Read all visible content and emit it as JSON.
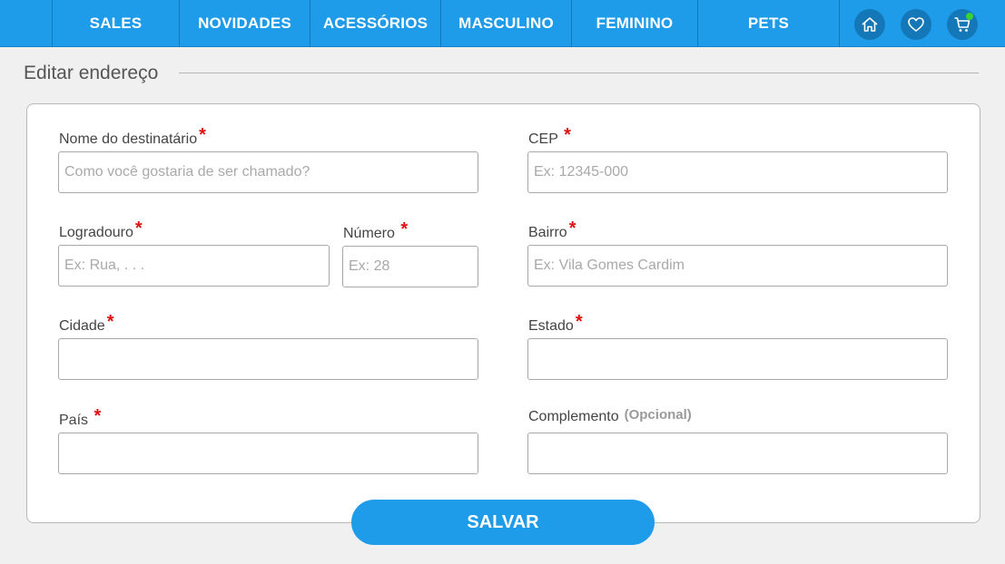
{
  "nav": {
    "items": [
      {
        "label": "SALES"
      },
      {
        "label": "NOVIDADES"
      },
      {
        "label": "ACESSÓRIOS"
      },
      {
        "label": "MASCULINO"
      },
      {
        "label": "FEMININO"
      },
      {
        "label": "PETS"
      }
    ],
    "icons": [
      "home-icon",
      "heart-icon",
      "cart-icon"
    ]
  },
  "page": {
    "title": "Editar endereço"
  },
  "form": {
    "required_mark": "*",
    "optional_text": "(Opcional)",
    "recipient": {
      "label": "Nome do destinatário",
      "placeholder": "Como você gostaria de ser chamado?",
      "value": ""
    },
    "cep": {
      "label": "CEP",
      "placeholder": "Ex: 12345-000",
      "value": ""
    },
    "street": {
      "label": "Logradouro",
      "placeholder": "Ex: Rua, . . .",
      "value": ""
    },
    "number": {
      "label": "Número",
      "placeholder": "Ex: 28",
      "value": ""
    },
    "district": {
      "label": "Bairro",
      "placeholder": "Ex: Vila Gomes Cardim",
      "value": ""
    },
    "city": {
      "label": "Cidade",
      "placeholder": "",
      "value": ""
    },
    "state": {
      "label": "Estado",
      "placeholder": "",
      "value": ""
    },
    "country": {
      "label": "País",
      "placeholder": "",
      "value": ""
    },
    "complement": {
      "label": "Complemento",
      "placeholder": "",
      "value": ""
    },
    "save_label": "SALVAR"
  },
  "colors": {
    "primary": "#1e9be9",
    "required": "#e01010",
    "background": "#f0f0f0"
  }
}
